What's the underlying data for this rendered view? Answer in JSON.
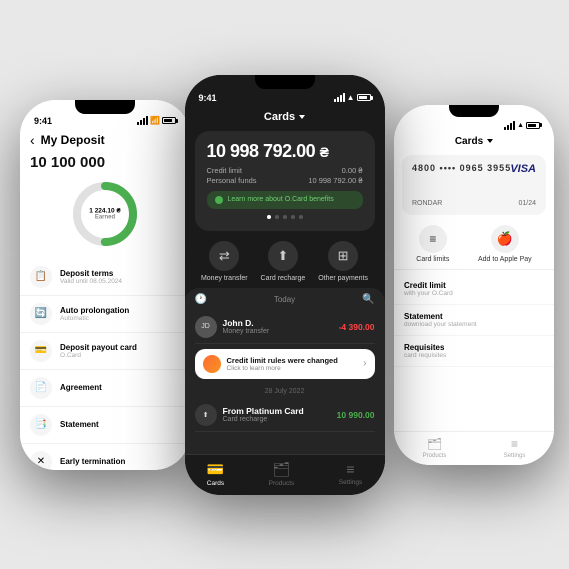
{
  "scene": {
    "bg_color": "#e5e5e5"
  },
  "left_phone": {
    "status_bar": {
      "time": "9:41"
    },
    "header": {
      "back": "‹",
      "title": "My Deposit"
    },
    "balance": "10 100 000",
    "donut": {
      "earned_amount": "1 224.10 ₴",
      "earned_label": "Earned"
    },
    "menu_items": [
      {
        "icon": "📋",
        "title": "Deposit terms",
        "sub": "Valid until 08.05.2024"
      },
      {
        "icon": "🔄",
        "title": "Auto prolongation",
        "sub": "Automatic"
      },
      {
        "icon": "💳",
        "title": "Deposit payout card",
        "sub": "O.Card"
      },
      {
        "icon": "📄",
        "title": "Agreement",
        "sub": ""
      },
      {
        "icon": "📑",
        "title": "Statement",
        "sub": ""
      },
      {
        "icon": "✕",
        "title": "Early termination",
        "sub": ""
      }
    ]
  },
  "center_phone": {
    "status_bar": {
      "time": "9:41"
    },
    "header": {
      "title": "Cards",
      "dropdown_icon": "▾"
    },
    "card": {
      "balance": "10 998 792.00",
      "currency": "₴",
      "credit_limit_label": "Credit limit",
      "credit_limit_value": "0.00 ₴",
      "personal_funds_label": "Personal funds",
      "personal_funds_value": "10 998 792.00 ₴"
    },
    "learn_btn": "Learn more about O.Card benefits",
    "action_buttons": [
      {
        "icon": "⇄",
        "label": "Money transfer"
      },
      {
        "icon": "⬆",
        "label": "Card recharge"
      },
      {
        "icon": "⊞",
        "label": "Other payments"
      }
    ],
    "transactions": {
      "date_today": "Today",
      "items": [
        {
          "avatar": "JD",
          "name": "John D.",
          "type": "Money transfer",
          "amount": "-4 390.00",
          "amount_type": "negative"
        }
      ],
      "notification": {
        "title": "Credit limit rules were changed",
        "sub": "Click to learn more"
      },
      "date_divider": "28 July 2022",
      "items2": [
        {
          "icon": "⬆",
          "name": "From Platinum Card",
          "type": "Card recharge",
          "amount": "10 990.00",
          "amount_type": "positive"
        }
      ]
    },
    "bottom_nav": [
      {
        "icon": "💳",
        "label": "Cards",
        "active": true
      },
      {
        "icon": "🗂",
        "label": "Products",
        "active": false
      },
      {
        "icon": "≡",
        "label": "Settings",
        "active": false
      }
    ]
  },
  "right_phone": {
    "status_bar": {
      "time": ""
    },
    "header": {
      "title": "Cards",
      "dropdown_icon": "▾"
    },
    "card": {
      "number": "•••• 0965 3955",
      "prefix": "4800",
      "holder": "RONDAR",
      "expiry": "01/24",
      "network": "VISA"
    },
    "action_buttons": [
      {
        "icon": "≡",
        "label": "Card limits"
      },
      {
        "icon": "🍎",
        "label": "Add to Apple Pay"
      }
    ],
    "menu_items": [
      {
        "title": "Credit limit",
        "sub": "with your O.Card"
      },
      {
        "title": "Statement",
        "sub": "download your statement"
      },
      {
        "title": "Requisites",
        "sub": "card requisites"
      }
    ],
    "bottom_nav": [
      {
        "icon": "🗂",
        "label": "Products"
      },
      {
        "icon": "≡",
        "label": "Settings"
      }
    ]
  }
}
